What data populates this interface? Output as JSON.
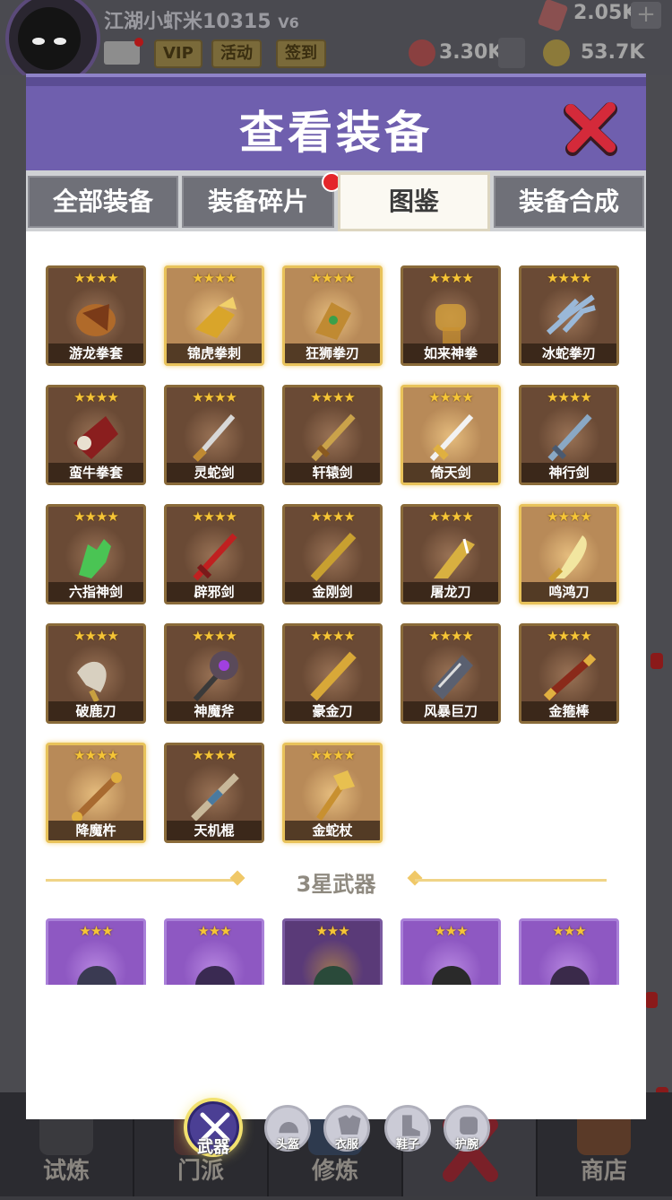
{
  "player": {
    "name": "江湖小虾米10315",
    "vip_level": "V6",
    "vip_label": "VIP",
    "activity_label": "活动",
    "checkin_label": "签到"
  },
  "resources": {
    "gems": "2.05K",
    "honor": "3.30K",
    "coins": "53.7K",
    "plus": "+"
  },
  "modal": {
    "title": "查看装备",
    "tabs": [
      {
        "label": "全部装备"
      },
      {
        "label": "装备碎片"
      },
      {
        "label": "图鉴"
      },
      {
        "label": "装备合成"
      }
    ],
    "section_title": "3星武器"
  },
  "four_star_items": [
    {
      "name": "游龙拳套",
      "stars": "★★★★",
      "icon": "dragon-gauntlet-icon"
    },
    {
      "name": "锦虎拳刺",
      "stars": "★★★★",
      "icon": "tiger-knuckle-icon"
    },
    {
      "name": "狂狮拳刃",
      "stars": "★★★★",
      "icon": "lion-fist-blade-icon"
    },
    {
      "name": "如来神拳",
      "stars": "★★★★",
      "icon": "buddha-fist-icon"
    },
    {
      "name": "冰蛇拳刃",
      "stars": "★★★★",
      "icon": "ice-snake-claw-icon"
    },
    {
      "name": "蛮牛拳套",
      "stars": "★★★★",
      "icon": "bull-gauntlet-icon"
    },
    {
      "name": "灵蛇剑",
      "stars": "★★★★",
      "icon": "snake-sword-icon"
    },
    {
      "name": "轩辕剑",
      "stars": "★★★★",
      "icon": "xuanyuan-sword-icon"
    },
    {
      "name": "倚天剑",
      "stars": "★★★★",
      "icon": "yitian-sword-icon"
    },
    {
      "name": "神行剑",
      "stars": "★★★★",
      "icon": "swift-sword-icon"
    },
    {
      "name": "六指神剑",
      "stars": "★★★★",
      "icon": "six-finger-hand-icon"
    },
    {
      "name": "辟邪剑",
      "stars": "★★★★",
      "icon": "red-sword-icon"
    },
    {
      "name": "金刚剑",
      "stars": "★★★★",
      "icon": "golden-sword-icon"
    },
    {
      "name": "屠龙刀",
      "stars": "★★★★",
      "icon": "dragon-slayer-blade-icon"
    },
    {
      "name": "鸣鸿刀",
      "stars": "★★★★",
      "icon": "minghong-blade-icon"
    },
    {
      "name": "破鹿刀",
      "stars": "★★★★",
      "icon": "broad-blade-icon"
    },
    {
      "name": "神魔斧",
      "stars": "★★★★",
      "icon": "demon-axe-icon"
    },
    {
      "name": "豪金刀",
      "stars": "★★★★",
      "icon": "gold-blade-icon"
    },
    {
      "name": "风暴巨刀",
      "stars": "★★★★",
      "icon": "storm-greatblade-icon"
    },
    {
      "name": "金箍棒",
      "stars": "★★★★",
      "icon": "golden-staff-icon"
    },
    {
      "name": "降魔杵",
      "stars": "★★★★",
      "icon": "demon-pestle-icon"
    },
    {
      "name": "天机棍",
      "stars": "★★★★",
      "icon": "heaven-staff-icon"
    },
    {
      "name": "金蛇杖",
      "stars": "★★★★",
      "icon": "golden-snake-staff-icon"
    }
  ],
  "three_star_items": [
    {
      "stars": "★★★",
      "icon": "spiked-gauntlet-icon"
    },
    {
      "stars": "★★★",
      "icon": "crescent-claw-icon"
    },
    {
      "stars": "★★★",
      "icon": "jade-claw-icon"
    },
    {
      "stars": "★★★",
      "icon": "iron-glove-icon"
    },
    {
      "stars": "★★★",
      "icon": "spike-claw-icon"
    }
  ],
  "categories": [
    {
      "label": "武器",
      "icon": "crossed-swords-icon"
    },
    {
      "label": "头盔",
      "icon": "helmet-icon"
    },
    {
      "label": "衣服",
      "icon": "armor-icon"
    },
    {
      "label": "鞋子",
      "icon": "boots-icon"
    },
    {
      "label": "护腕",
      "icon": "bracer-icon"
    }
  ],
  "bottom_nav": [
    {
      "label": "试炼"
    },
    {
      "label": "门派"
    },
    {
      "label": "修炼"
    },
    {
      "label": ""
    },
    {
      "label": "商店"
    }
  ],
  "colors": {
    "modal_header": "#6f5fae",
    "gold_frame": "#e8c25a",
    "purple_frame": "#8e58c2",
    "star": "#f6c536",
    "close_x": "#d42a3a"
  }
}
